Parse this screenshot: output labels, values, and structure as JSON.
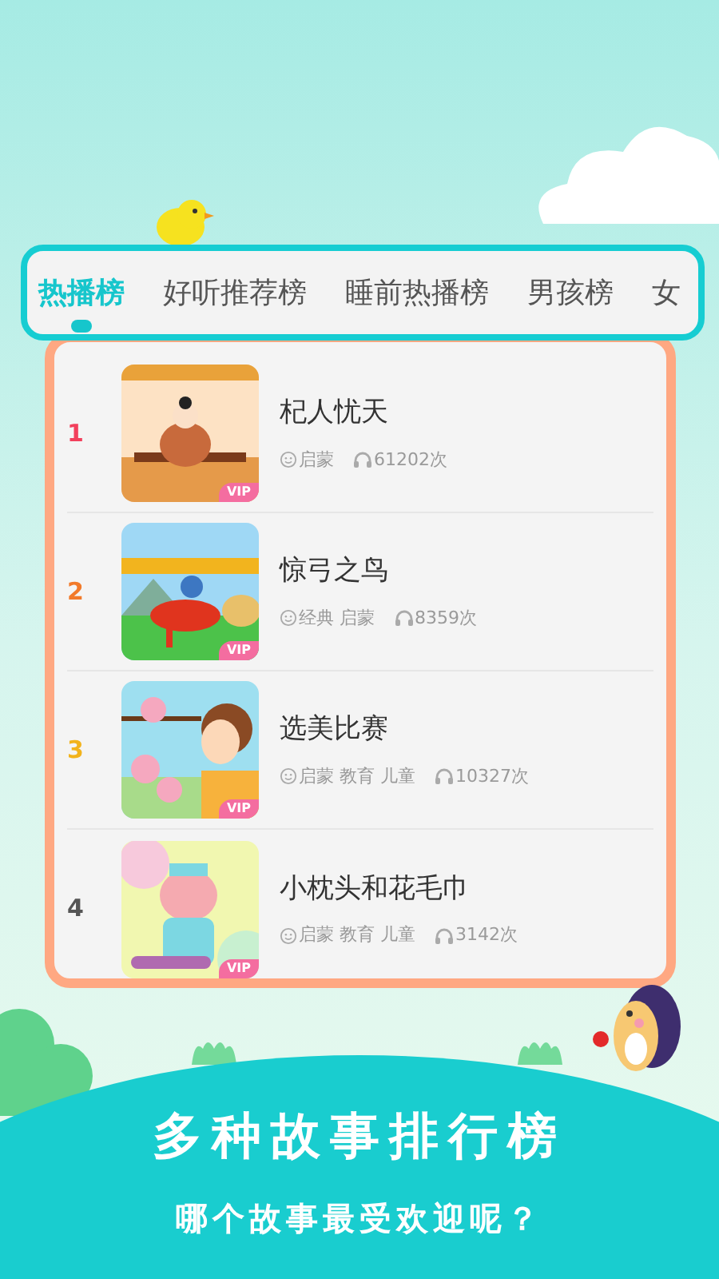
{
  "tabs": [
    {
      "label": "热播榜",
      "selected": true
    },
    {
      "label": "好听推荐榜",
      "selected": false
    },
    {
      "label": "睡前热播榜",
      "selected": false
    },
    {
      "label": "男孩榜",
      "selected": false
    },
    {
      "label": "女",
      "selected": false
    }
  ],
  "stories": [
    {
      "rank": "1",
      "color": "#f2405c",
      "title": "杞人忧天",
      "tags": "启蒙",
      "plays": "61202次",
      "badge": "VIP"
    },
    {
      "rank": "2",
      "color": "#f27a2a",
      "title": "惊弓之鸟",
      "tags": "经典 启蒙",
      "plays": "8359次",
      "badge": "VIP"
    },
    {
      "rank": "3",
      "color": "#f2b31c",
      "title": "选美比赛",
      "tags": "启蒙 教育 儿童",
      "plays": "10327次",
      "badge": "VIP"
    },
    {
      "rank": "4",
      "color": "#555555",
      "title": "小枕头和花毛巾",
      "tags": "启蒙 教育 儿童",
      "plays": "3142次",
      "badge": "VIP"
    }
  ],
  "headline": "多种故事排行榜",
  "subline": "哪个故事最受欢迎呢？"
}
